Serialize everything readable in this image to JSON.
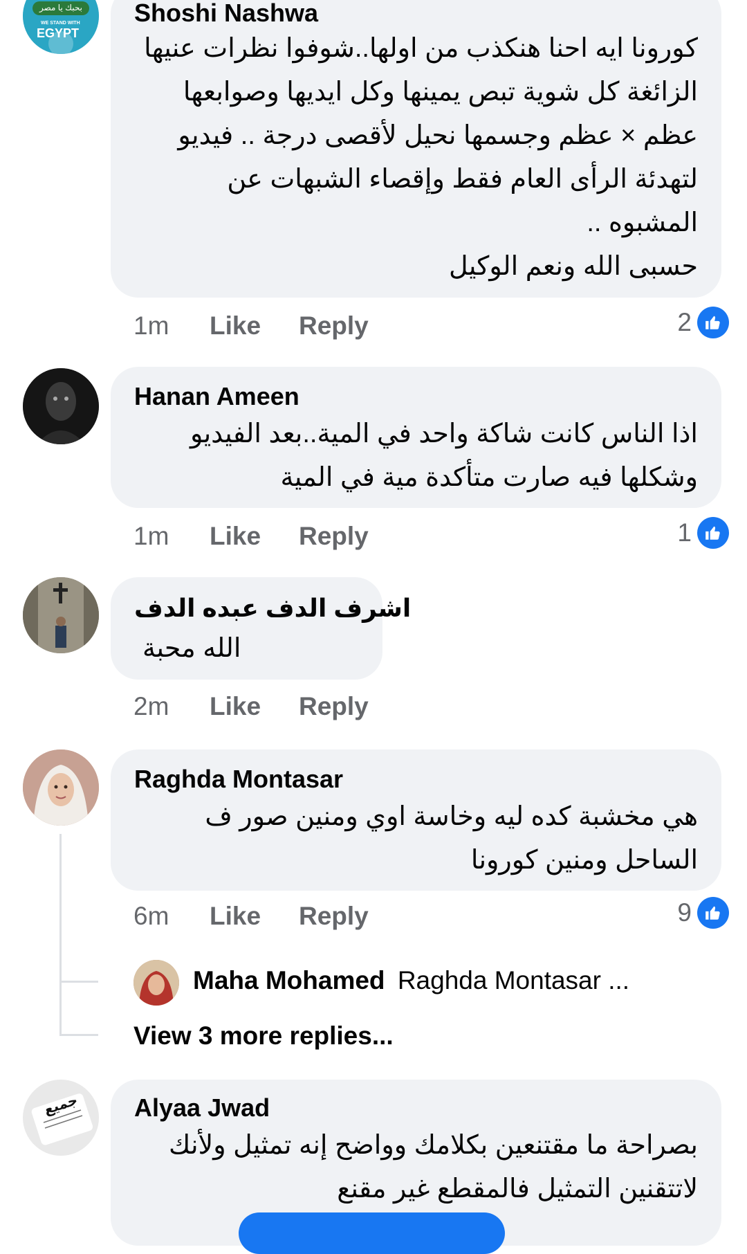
{
  "comments": [
    {
      "name": "Shoshi Nashwa",
      "lines": [
        "كورونا ايه احنا هنكذب من اولها..شوفوا نظرات عنيها",
        "الزائغة كل شوية تبص يمينها وكل ايديها وصوابعها",
        "عظم × عظم وجسمها نحيل لأقصى درجة .. فيديو",
        "لتهدئة الرأى العام فقط وإقصاء الشبهات عن",
        "المشبوه ..",
        "حسبى الله ونعم الوكيل"
      ],
      "time": "1m",
      "like": "Like",
      "reply": "Reply",
      "likes_count": "2",
      "avatar_text_top": "بحبك يا مصر",
      "avatar_text_main": "EGYPT",
      "avatar_text_small": "WE STAND WITH"
    },
    {
      "name": "Hanan Ameen",
      "lines": [
        "اذا الناس كانت شاكة واحد في المية..بعد الفيديو",
        "وشكلها فيه صارت متأكدة مية في المية"
      ],
      "time": "1m",
      "like": "Like",
      "reply": "Reply",
      "likes_count": "1"
    },
    {
      "name": "اشرف الدف عبده الدف",
      "lines": [
        "الله محبة"
      ],
      "time": "2m",
      "like": "Like",
      "reply": "Reply"
    },
    {
      "name": "Raghda Montasar",
      "lines": [
        "هي مخشبة كده ليه وخاسة اوي ومنين صور ف",
        "الساحل ومنين كورونا"
      ],
      "time": "6m",
      "like": "Like",
      "reply": "Reply",
      "likes_count": "9",
      "reply_preview": {
        "name": "Maha Mohamed",
        "text": "Raghda Montasar ..."
      },
      "view_more": "View 3 more replies..."
    },
    {
      "name": "Alyaa Jwad",
      "lines": [
        "بصراحة ما مقتنعين بكلامك وواضح إنه تمثيل  ولأنك",
        "لاتتقنين التمثيل فالمقطع غير مقنع"
      ],
      "avatar_text_main": "جميع"
    }
  ],
  "colors": {
    "bubble": "#f0f2f5",
    "secondary_text": "#65676b",
    "like_blue": "#1877f2",
    "thread_line": "#dcdfe3"
  }
}
